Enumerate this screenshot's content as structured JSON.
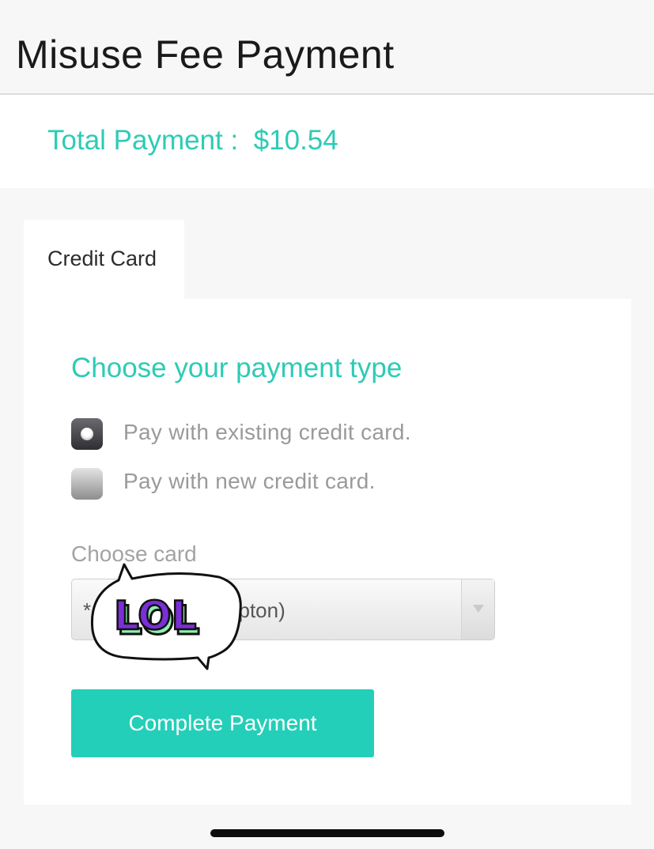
{
  "header": {
    "title": "Misuse Fee Payment"
  },
  "summary": {
    "label": "Total Payment :",
    "amount": "$10.54"
  },
  "tabs": [
    {
      "label": "Credit Card",
      "active": true
    }
  ],
  "payment": {
    "section_title": "Choose your payment type",
    "options": [
      {
        "label": "Pay with existing credit card.",
        "selected": true
      },
      {
        "label": "Pay with new credit card.",
        "selected": false
      }
    ],
    "card_field_label": "Choose card",
    "card_selected_value": "* (Greggory Hampton)",
    "submit_label": "Complete Payment"
  },
  "sticker": {
    "text": "LOL"
  },
  "colors": {
    "accent": "#2dcbb6",
    "button": "#23cfb8",
    "sticker_purple": "#7b2fd6",
    "sticker_green": "#8ff0b0"
  }
}
